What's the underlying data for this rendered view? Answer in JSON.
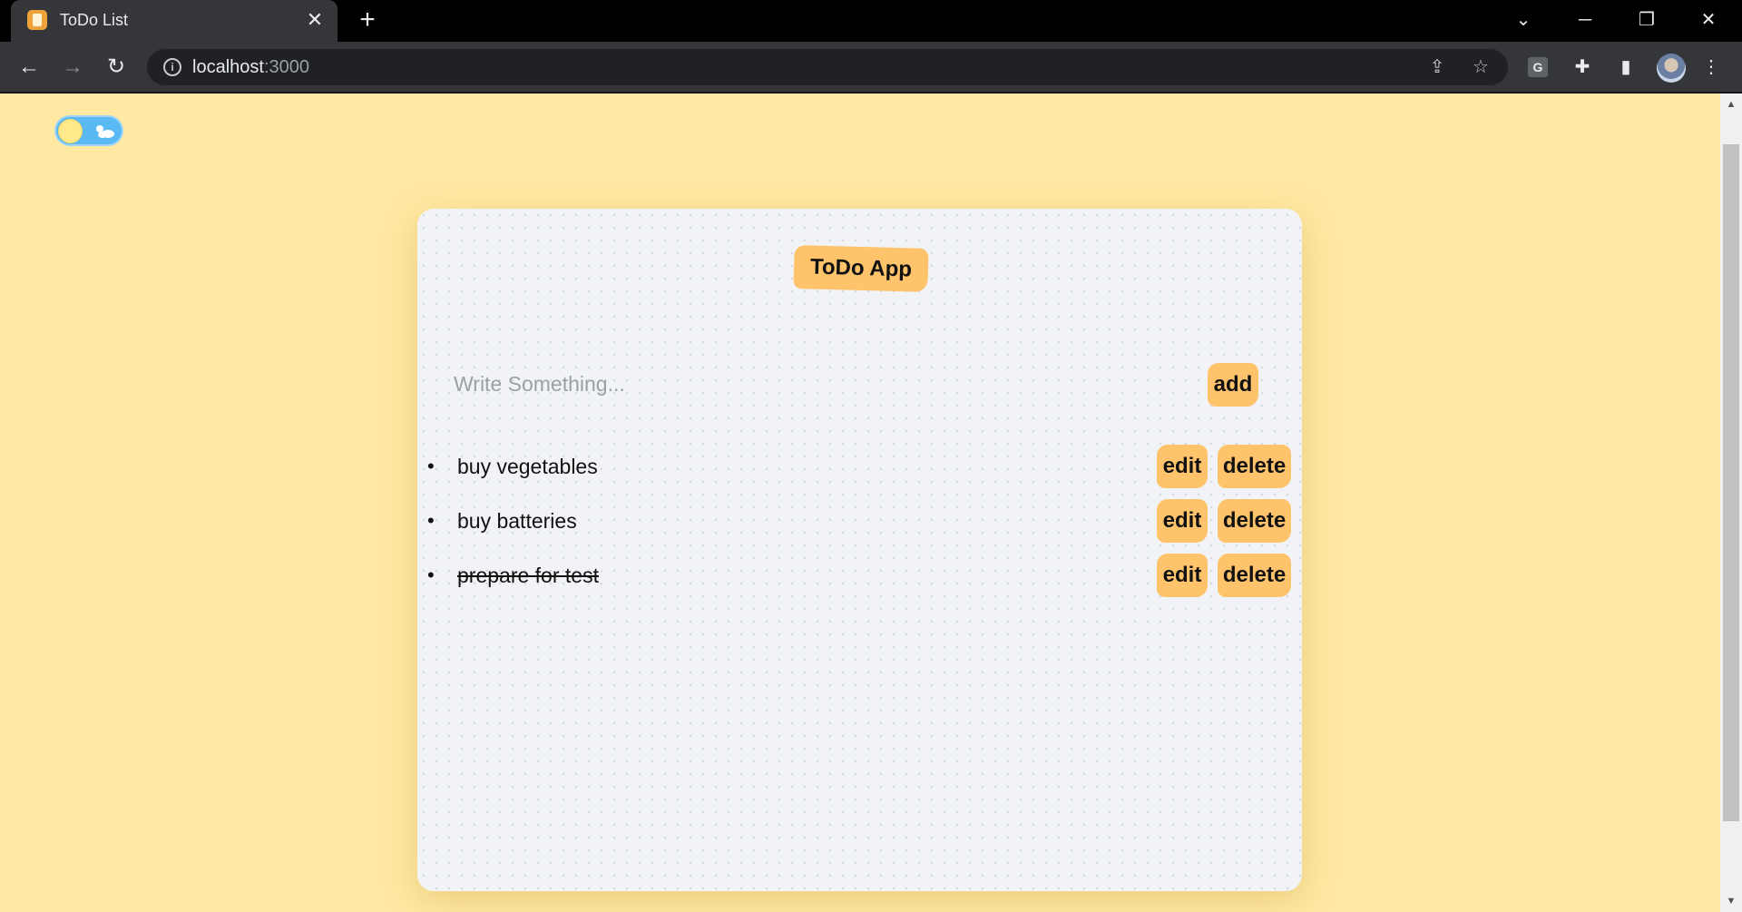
{
  "browser": {
    "tab_title": "ToDo List",
    "url_host": "localhost",
    "url_port": ":3000",
    "extension_label": "G"
  },
  "app": {
    "title": "ToDo App",
    "input": {
      "value": "",
      "placeholder": "Write Something..."
    },
    "add_label": "add",
    "edit_label": "edit",
    "delete_label": "delete",
    "todos": [
      {
        "text": "buy vegetables",
        "completed": false
      },
      {
        "text": "buy batteries",
        "completed": false
      },
      {
        "text": "prepare for test",
        "completed": true
      }
    ]
  },
  "colors": {
    "page_background": "#ffe9a3",
    "card_background": "#f1f3f6",
    "accent": "#ffc46b",
    "toggle_track": "#5ab8f2",
    "toggle_sun": "#ffe98a"
  },
  "icons": {
    "theme_toggle": "sun-cloud-toggle",
    "tab_favicon": "notepad-icon"
  }
}
